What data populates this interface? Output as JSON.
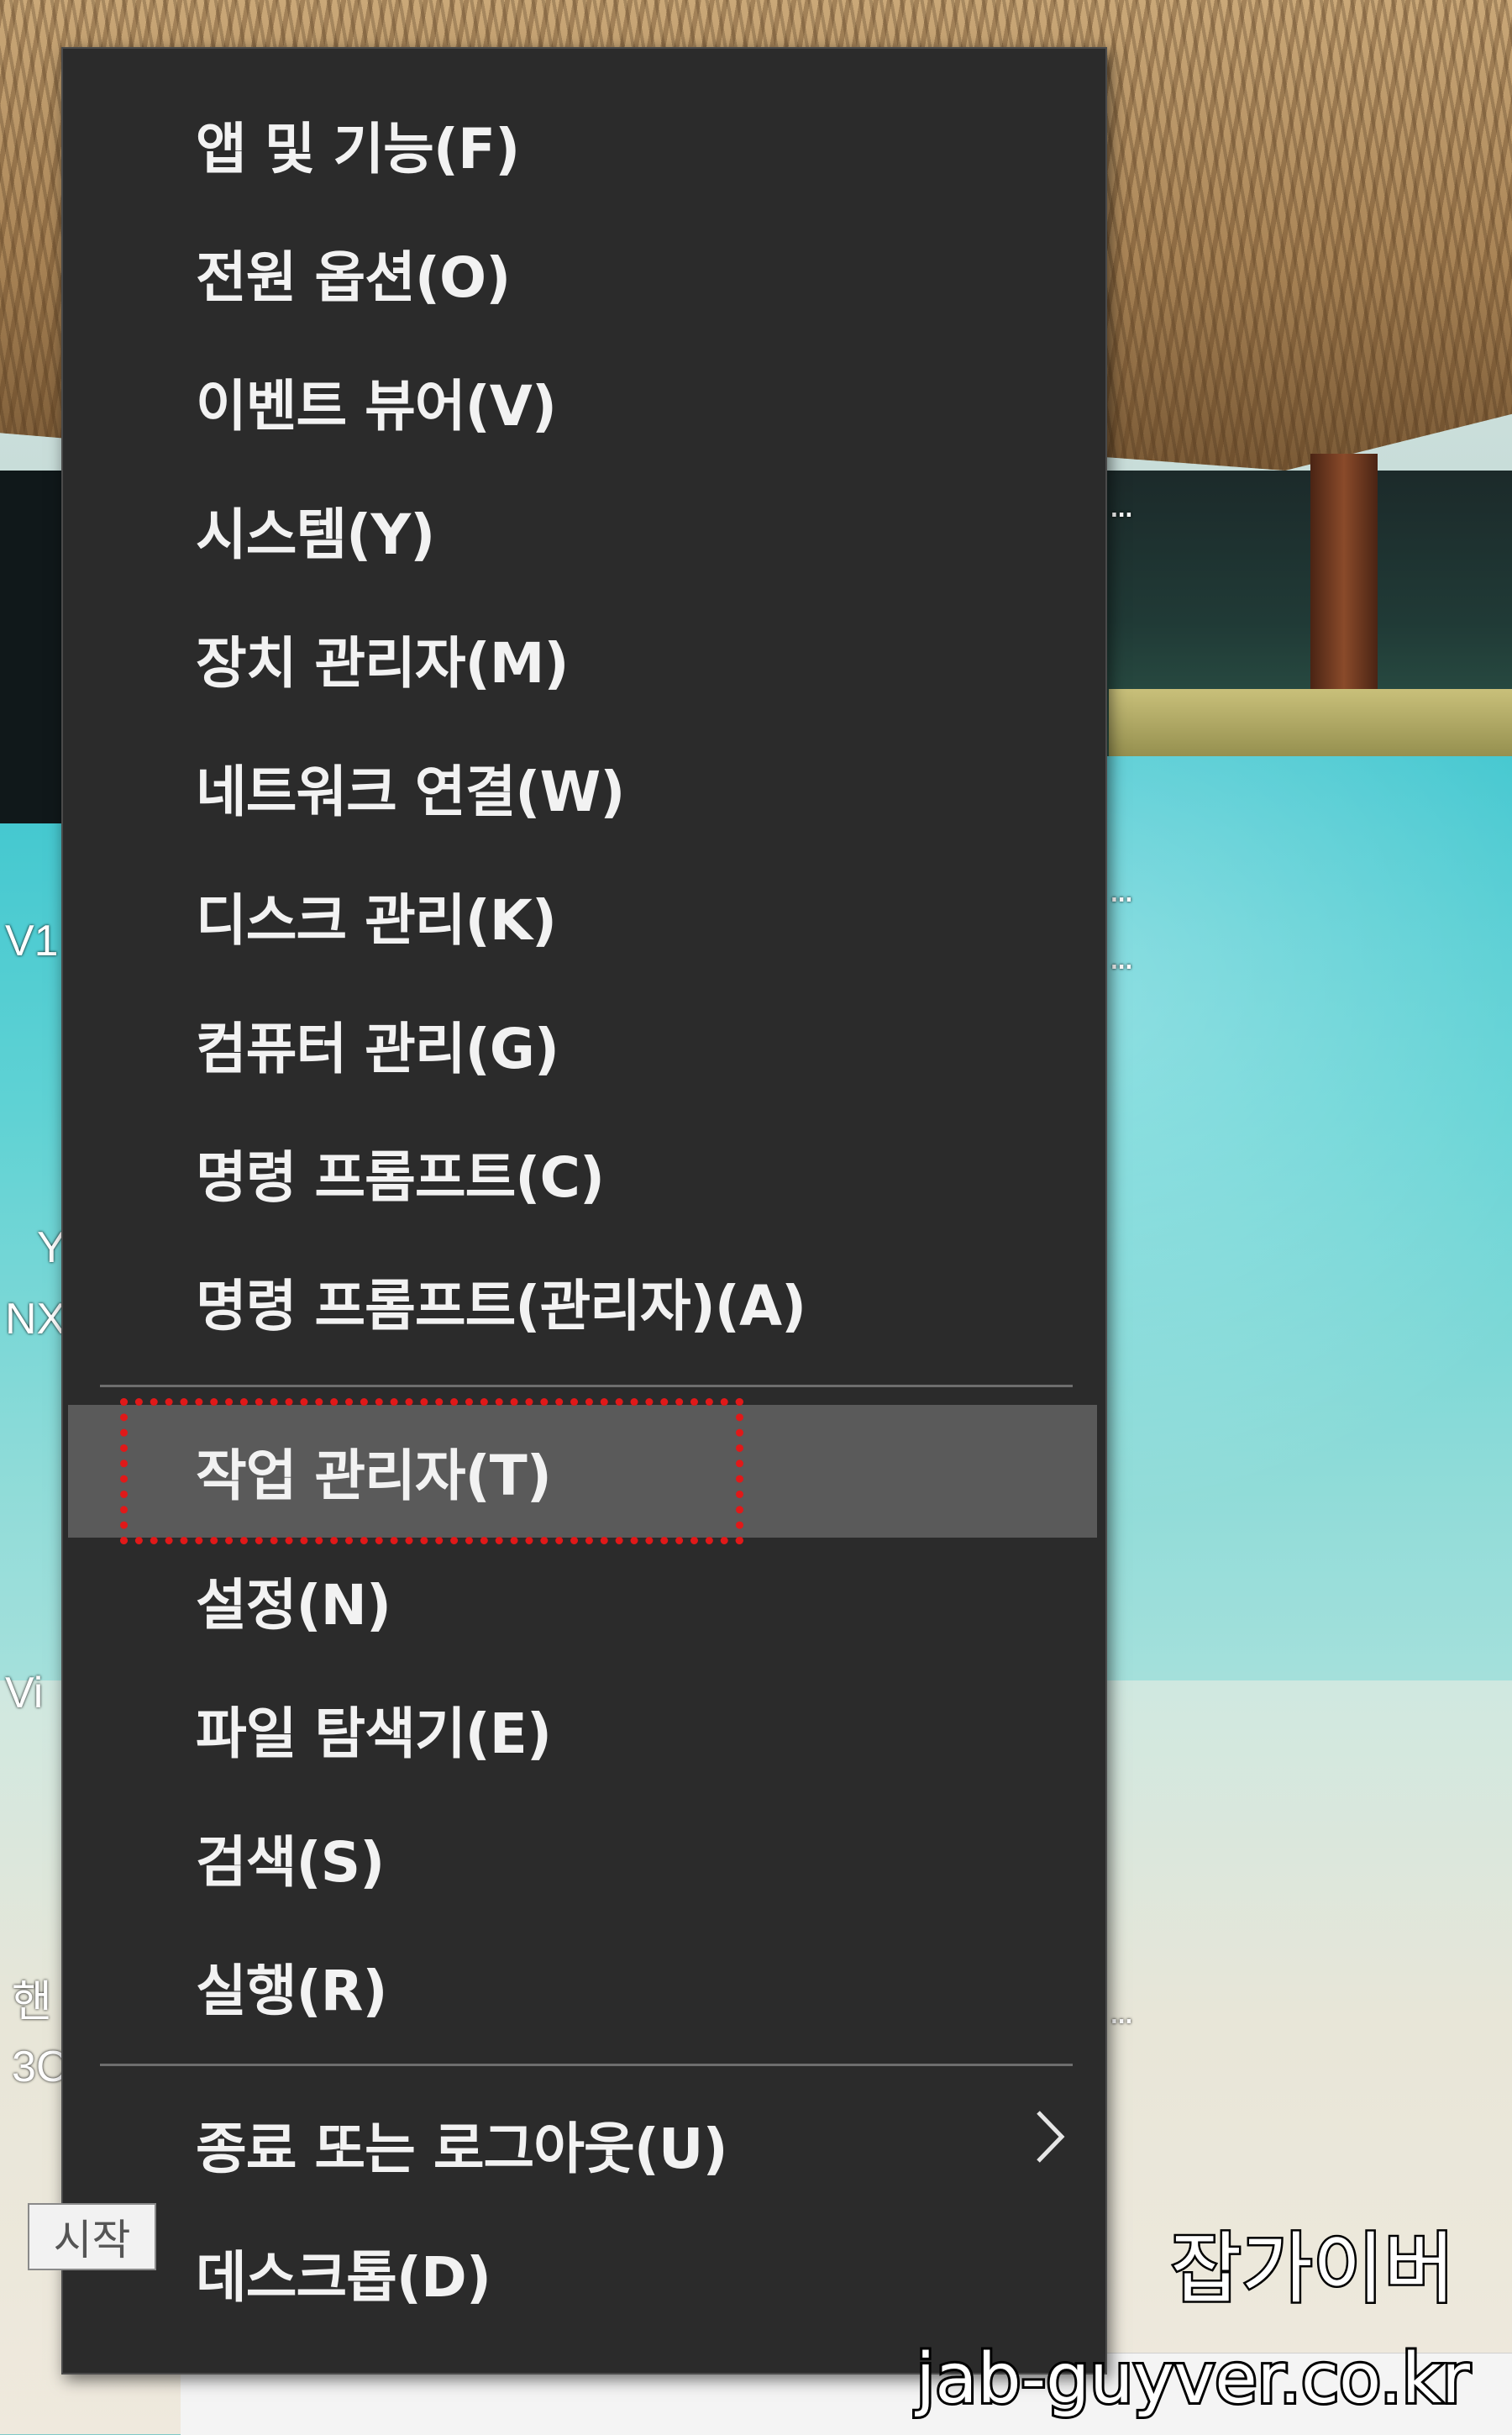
{
  "desktop": {
    "fragments": [
      "V1",
      "NX",
      "Y",
      "Vi",
      "핸",
      "3C"
    ],
    "dots": "..."
  },
  "menu": {
    "items": [
      {
        "label": "앱 및 기능(F)"
      },
      {
        "label": "전원 옵션(O)"
      },
      {
        "label": "이벤트 뷰어(V)"
      },
      {
        "label": "시스템(Y)"
      },
      {
        "label": "장치 관리자(M)"
      },
      {
        "label": "네트워크 연결(W)"
      },
      {
        "label": "디스크 관리(K)"
      },
      {
        "label": "컴퓨터 관리(G)"
      },
      {
        "label": "명령 프롬프트(C)"
      },
      {
        "label": "명령 프롬프트(관리자)(A)"
      },
      {
        "label": "작업 관리자(T)",
        "state": "highlighted"
      },
      {
        "label": "설정(N)"
      },
      {
        "label": "파일 탐색기(E)"
      },
      {
        "label": "검색(S)"
      },
      {
        "label": "실행(R)"
      },
      {
        "label": "종료 또는 로그아웃(U)",
        "submenu_icon": "chevron-right-icon"
      },
      {
        "label": "데스크톱(D)"
      }
    ],
    "highlight_color": "#5a5a5a",
    "background_color": "#2b2b2b",
    "focus_outline_color": "#e01919"
  },
  "tooltip": {
    "text": "시작"
  },
  "watermark": {
    "line1": "잡가이버",
    "line2": "jab-guyver.co.kr"
  }
}
